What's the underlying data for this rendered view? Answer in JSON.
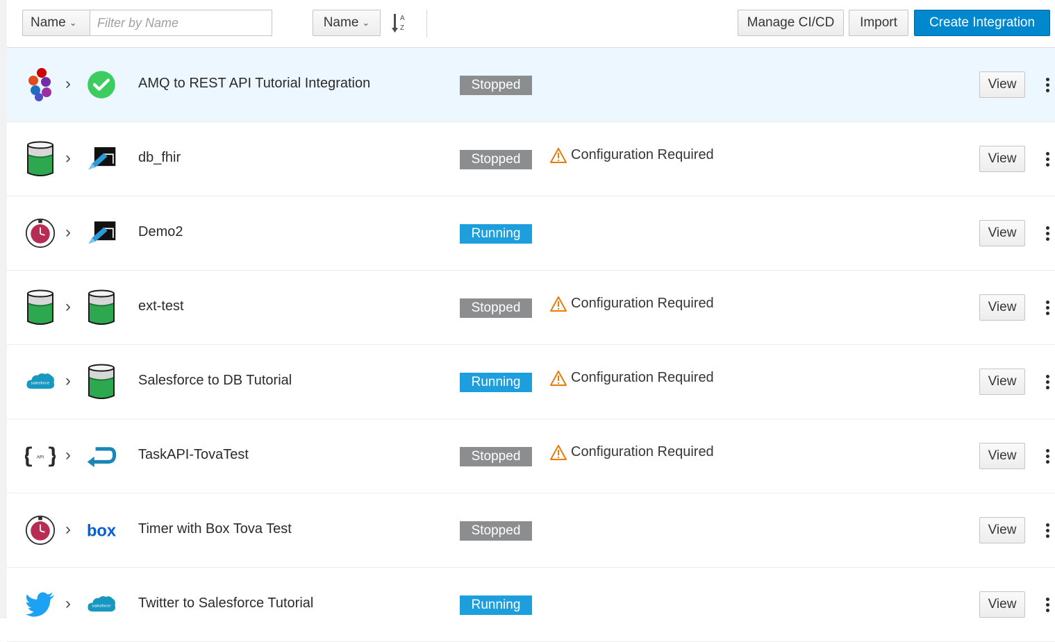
{
  "toolbar": {
    "filter_type": "Name",
    "filter_placeholder": "Filter by Name",
    "sort_field": "Name",
    "manage_cicd": "Manage CI/CD",
    "import": "Import",
    "create": "Create Integration"
  },
  "view_label": "View",
  "integrations": [
    {
      "name": "AMQ to REST API Tutorial Integration",
      "status": "Stopped",
      "warning": "",
      "start_icon": "amq-icon",
      "end_icon": "check-circle-icon"
    },
    {
      "name": "db_fhir",
      "status": "Stopped",
      "warning": "Configuration Required",
      "start_icon": "database-icon",
      "end_icon": "fhir-icon"
    },
    {
      "name": "Demo2",
      "status": "Running",
      "warning": "",
      "start_icon": "timer-icon",
      "end_icon": "fhir-icon"
    },
    {
      "name": "ext-test",
      "status": "Stopped",
      "warning": "Configuration Required",
      "start_icon": "database-icon",
      "end_icon": "database-icon"
    },
    {
      "name": "Salesforce to DB Tutorial",
      "status": "Running",
      "warning": "Configuration Required",
      "start_icon": "salesforce-icon",
      "end_icon": "database-icon"
    },
    {
      "name": "TaskAPI-TovaTest",
      "status": "Stopped",
      "warning": "Configuration Required",
      "start_icon": "api-icon",
      "end_icon": "api-return-icon"
    },
    {
      "name": "Timer with Box Tova Test",
      "status": "Stopped",
      "warning": "",
      "start_icon": "timer-icon",
      "end_icon": "box-icon"
    },
    {
      "name": "Twitter to Salesforce Tutorial",
      "status": "Running",
      "warning": "",
      "start_icon": "twitter-icon",
      "end_icon": "salesforce-icon"
    }
  ],
  "colors": {
    "primary": "#0088ce",
    "running": "#1d9fde",
    "stopped": "#8b8d8f",
    "warning": "#ec7a08",
    "selected_row": "#edf7ff"
  }
}
